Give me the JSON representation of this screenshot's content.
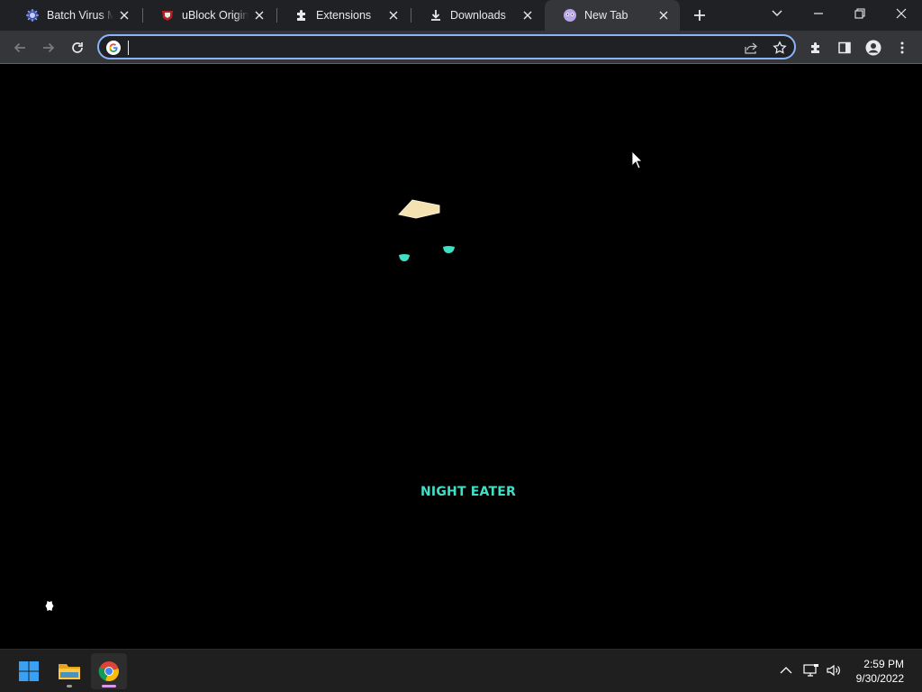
{
  "browser": {
    "tabs": [
      {
        "title": "Batch Virus Maker",
        "icon": "virus-favicon",
        "active": false
      },
      {
        "title": "uBlock Origin - free",
        "icon": "ublock-favicon",
        "active": false
      },
      {
        "title": "Extensions",
        "icon": "puzzle-icon",
        "active": false
      },
      {
        "title": "Downloads",
        "icon": "download-icon",
        "active": false
      },
      {
        "title": "New Tab",
        "icon": "night-eye-favicon",
        "active": true
      }
    ],
    "omnibox": {
      "value": "",
      "placeholder": ""
    }
  },
  "page": {
    "brand_text": "NIGHT EATER"
  },
  "taskbar": {
    "apps": [
      "windows-start",
      "file-explorer",
      "google-chrome"
    ],
    "time": "2:59 PM",
    "date": "9/30/2022"
  },
  "colors": {
    "tabstrip": "#202124",
    "toolbar": "#35363a",
    "accent": "#8ab4f8",
    "brand": "#3fe0c5",
    "taskbar": "#1f1f1f"
  }
}
